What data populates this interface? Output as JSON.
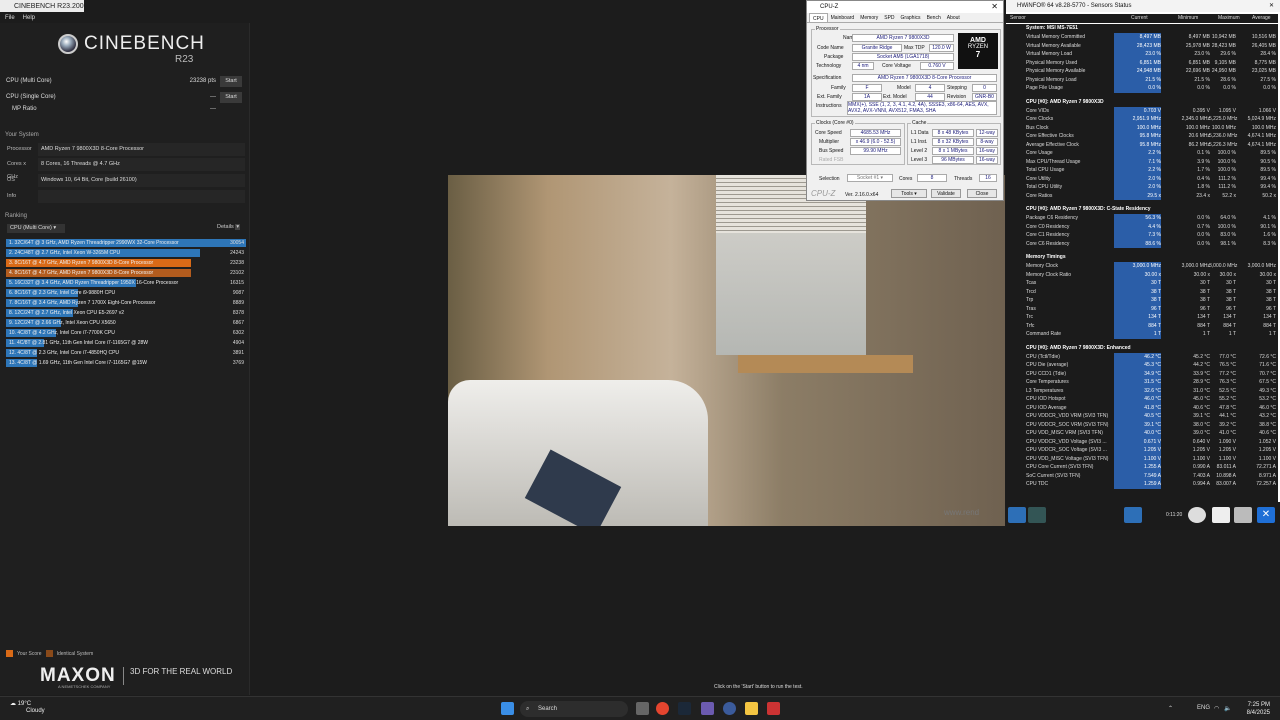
{
  "cinebench": {
    "title": "CINEBENCH R23.200",
    "menu": [
      "File",
      "Help"
    ],
    "logo": "CINEBENCH",
    "logo_sub": "R23",
    "multi_label": "CPU (Multi Core)",
    "multi_score": "23238 pts",
    "single_label": "CPU (Single Core)",
    "single_score": "---",
    "mp_label": "MP Ratio",
    "mp_score": "---",
    "start_label": "Start",
    "your_system": "Your System",
    "system": [
      {
        "k": "Processor",
        "v": "AMD Ryzen 7 9800X3D 8-Core Processor"
      },
      {
        "k": "Cores x GHz",
        "v": "8 Cores, 16 Threads @ 4.7 GHz"
      },
      {
        "k": "OS",
        "v": "Windows 10, 64 Bit, Core (build 26100)"
      },
      {
        "k": "Info",
        "v": ""
      }
    ],
    "ranking": "Ranking",
    "ranking_dd": "CPU (Multi Core)",
    "details": "Details",
    "ranks": [
      {
        "label": "1. 32C/64T @ 3 GHz, AMD Ryzen Threadripper 2990WX 32-Core Processor",
        "score": "30054",
        "frac": 1.0,
        "color": "#2e76b8"
      },
      {
        "label": "2. 24C/48T @ 2.7 GHz, Intel Xeon W-3265M CPU",
        "score": "24243",
        "frac": 0.81,
        "color": "#2e76b8"
      },
      {
        "label": "3. 8C/16T @ 4.7 GHz, AMD Ryzen 7 9800X3D 8-Core Processor",
        "score": "23238",
        "frac": 0.77,
        "color": "#d96a17"
      },
      {
        "label": "4. 8C/16T @ 4.7 GHz, AMD Ryzen 7 9800X3D 8-Core Processor",
        "score": "23102",
        "frac": 0.77,
        "color": "#b35c1e"
      },
      {
        "label": "5. 16C/32T @ 3.4 GHz, AMD Ryzen Threadripper 1950X 16-Core Processor",
        "score": "16315",
        "frac": 0.54,
        "color": "#2e76b8"
      },
      {
        "label": "6. 8C/16T @ 2.3 GHz, Intel Core i9-9880H CPU",
        "score": "9087",
        "frac": 0.3,
        "color": "#2e76b8"
      },
      {
        "label": "7. 8C/16T @ 3.4 GHz, AMD Ryzen 7 1700X Eight-Core Processor",
        "score": "8889",
        "frac": 0.3,
        "color": "#2e76b8"
      },
      {
        "label": "8. 12C/24T @ 2.7 GHz, Intel Xeon CPU E5-2697 v2",
        "score": "8378",
        "frac": 0.28,
        "color": "#2e76b8"
      },
      {
        "label": "9. 12C/24T @ 2.66 GHz, Intel Xeon CPU X5650",
        "score": "6867",
        "frac": 0.23,
        "color": "#2e76b8"
      },
      {
        "label": "10. 4C/8T @ 4.2 GHz, Intel Core i7-7700K CPU",
        "score": "6302",
        "frac": 0.21,
        "color": "#2e76b8"
      },
      {
        "label": "11. 4C/8T @ 2.81 GHz, 11th Gen Intel Core i7-1165G7 @ 28W",
        "score": "4904",
        "frac": 0.16,
        "color": "#2e76b8"
      },
      {
        "label": "12. 4C/8T @ 2.3 GHz, Intel Core i7-4850HQ CPU",
        "score": "3891",
        "frac": 0.13,
        "color": "#2e76b8"
      },
      {
        "label": "13. 4C/8T @ 1.69 GHz, 11th Gen Intel Core i7-1165G7 @15W",
        "score": "3769",
        "frac": 0.13,
        "color": "#2e76b8"
      }
    ],
    "legend_your": "Your Score",
    "legend_identical": "Identical System",
    "maxon": "MAXON",
    "maxon_sub": "A NEMETSCHEK COMPANY",
    "tagline": "3D FOR THE REAL WORLD",
    "status": "Click on the 'Start' button to run the test.",
    "watermark": "www.rend"
  },
  "cpuz": {
    "title": "CPU-Z",
    "tabs": [
      "CPU",
      "Mainboard",
      "Memory",
      "SPD",
      "Graphics",
      "Bench",
      "About"
    ],
    "processor_grp": "Processor",
    "name_k": "Name",
    "name": "AMD Ryzen 7 9800X3D",
    "codename_k": "Code Name",
    "codename": "Granite Ridge",
    "tdp_k": "Max TDP",
    "tdp": "120.0 W",
    "package_k": "Package",
    "package": "Socket AM5 (LGA1718)",
    "tech_k": "Technology",
    "tech": "4 nm",
    "cv_k": "Core Voltage",
    "cv": "0.760 V",
    "spec_k": "Specification",
    "spec": "AMD Ryzen 7 9800X3D 8-Core Processor",
    "family_k": "Family",
    "family": "F",
    "model_k": "Model",
    "model": "4",
    "stepping_k": "Stepping",
    "stepping": "0",
    "extfam_k": "Ext. Family",
    "extfam": "1A",
    "extmod_k": "Ext. Model",
    "extmod": "44",
    "rev_k": "Revision",
    "rev": "GNR-B0",
    "instr_k": "Instructions",
    "instr": "MMX(+), SSE (1, 2, 3, 4.1, 4.2, 4A), SSSE3, x86-64, AES, AVX, AVX2, AVX-VNNI, AVX512, FMA3, SHA",
    "clocks_grp": "Clocks (Core #0)",
    "cs_k": "Core Speed",
    "cs": "4685.53 MHz",
    "mult_k": "Multiplier",
    "mult": "x 46.9 (6.0 - 52.5)",
    "bus_k": "Bus Speed",
    "bus": "99.90 MHz",
    "fsb_k": "Rated FSB",
    "cache_grp": "Cache",
    "l1d_k": "L1 Data",
    "l1d": "8 x 48 KBytes",
    "l1d_w": "12-way",
    "l1i_k": "L1 Inst.",
    "l1i": "8 x 32 KBytes",
    "l1i_w": "8-way",
    "l2_k": "Level 2",
    "l2": "8 x 1 MBytes",
    "l2_w": "16-way",
    "l3_k": "Level 3",
    "l3": "96 MBytes",
    "l3_w": "16-way",
    "sel_k": "Selection",
    "sel": "Socket #1",
    "cores_k": "Cores",
    "cores": "8",
    "threads_k": "Threads",
    "threads": "16",
    "brand": "CPU-Z",
    "ver": "Ver. 2.16.0.x64",
    "tools": "Tools",
    "validate": "Validate",
    "close": "Close",
    "amd": "AMD",
    "ryzen": "RYZEN",
    "seven": "7"
  },
  "hwinfo": {
    "title": "HWiNFO® 64 v8.28-5770 - Sensors Status",
    "cols": {
      "sensor": "Sensor",
      "current": "Current",
      "min": "Minimum",
      "max": "Maximum",
      "avg": "Average"
    },
    "rows": [
      {
        "t": "sec",
        "n": "System: MSI MS-7E51"
      },
      {
        "n": "Virtual Memory Committed",
        "c": "8,497 MB",
        "mi": "8,497 MB",
        "ma": "10,942 MB",
        "av": "10,516 MB"
      },
      {
        "n": "Virtual Memory Available",
        "c": "28,423 MB",
        "mi": "25,978 MB",
        "ma": "28,423 MB",
        "av": "26,405 MB"
      },
      {
        "n": "Virtual Memory Load",
        "c": "23.0 %",
        "mi": "23.0 %",
        "ma": "29.6 %",
        "av": "28.4 %"
      },
      {
        "n": "Physical Memory Used",
        "c": "6,851 MB",
        "mi": "6,851 MB",
        "ma": "9,105 MB",
        "av": "8,775 MB"
      },
      {
        "n": "Physical Memory Available",
        "c": "24,948 MB",
        "mi": "22,696 MB",
        "ma": "24,950 MB",
        "av": "23,025 MB"
      },
      {
        "n": "Physical Memory Load",
        "c": "21.5 %",
        "mi": "21.5 %",
        "ma": "28.6 %",
        "av": "27.5 %"
      },
      {
        "n": "Page File Usage",
        "c": "0.0 %",
        "mi": "0.0 %",
        "ma": "0.0 %",
        "av": "0.0 %"
      },
      {
        "t": "gap"
      },
      {
        "t": "sec",
        "n": "CPU [#0]: AMD Ryzen 7 9800X3D"
      },
      {
        "n": "Core VIDs",
        "c": "0.703 V",
        "mi": "0.395 V",
        "ma": "1.095 V",
        "av": "1.066 V"
      },
      {
        "n": "Core Clocks",
        "c": "2,951.9 MHz",
        "mi": "2,345.0 MHz",
        "ma": "5,225.0 MHz",
        "av": "5,024.9 MHz"
      },
      {
        "n": "Bus Clock",
        "c": "100.0 MHz",
        "mi": "100.0 MHz",
        "ma": "100.0 MHz",
        "av": "100.0 MHz"
      },
      {
        "n": "Core Effective Clocks",
        "c": "95.8 MHz",
        "mi": "20.6 MHz",
        "ma": "5,236.0 MHz",
        "av": "4,674.1 MHz"
      },
      {
        "n": "Average Effective Clock",
        "c": "95.8 MHz",
        "mi": "86.2 MHz",
        "ma": "5,226.3 MHz",
        "av": "4,674.1 MHz"
      },
      {
        "n": "Core Usage",
        "c": "2.2 %",
        "mi": "0.1 %",
        "ma": "100.0 %",
        "av": "89.5 %"
      },
      {
        "n": "Max CPU/Thread Usage",
        "c": "7.1 %",
        "mi": "3.9 %",
        "ma": "100.0 %",
        "av": "90.5 %"
      },
      {
        "n": "Total CPU Usage",
        "c": "2.2 %",
        "mi": "1.7 %",
        "ma": "100.0 %",
        "av": "89.5 %"
      },
      {
        "n": "Core Utility",
        "c": "2.0 %",
        "mi": "0.4 %",
        "ma": "111.2 %",
        "av": "99.4 %"
      },
      {
        "n": "Total CPU Utility",
        "c": "2.0 %",
        "mi": "1.8 %",
        "ma": "111.2 %",
        "av": "99.4 %"
      },
      {
        "n": "Core Ratios",
        "c": "29.5 x",
        "mi": "23.4 x",
        "ma": "52.2 x",
        "av": "50.2 x"
      },
      {
        "t": "gap"
      },
      {
        "t": "sec",
        "n": "CPU [#0]: AMD Ryzen 7 9800X3D: C-State Residency"
      },
      {
        "n": "Package C6 Residency",
        "c": "56.3 %",
        "mi": "0.0 %",
        "ma": "64.0 %",
        "av": "4.1 %"
      },
      {
        "n": "Core C0 Residency",
        "c": "4.4 %",
        "mi": "0.7 %",
        "ma": "100.0 %",
        "av": "90.1 %"
      },
      {
        "n": "Core C1 Residency",
        "c": "7.3 %",
        "mi": "0.0 %",
        "ma": "83.0 %",
        "av": "1.6 %"
      },
      {
        "n": "Core C6 Residency",
        "c": "88.6 %",
        "mi": "0.0 %",
        "ma": "98.1 %",
        "av": "8.3 %"
      },
      {
        "t": "gap"
      },
      {
        "t": "sec",
        "n": "Memory Timings"
      },
      {
        "n": "Memory Clock",
        "c": "3,000.0 MHz",
        "mi": "3,000.0 MHz",
        "ma": "3,000.0 MHz",
        "av": "3,000.0 MHz"
      },
      {
        "n": "Memory Clock Ratio",
        "c": "30.00 x",
        "mi": "30.00 x",
        "ma": "30.00 x",
        "av": "30.00 x"
      },
      {
        "n": "Tcas",
        "c": "30 T",
        "mi": "30 T",
        "ma": "30 T",
        "av": "30 T"
      },
      {
        "n": "Trcd",
        "c": "38 T",
        "mi": "38 T",
        "ma": "38 T",
        "av": "38 T"
      },
      {
        "n": "Trp",
        "c": "38 T",
        "mi": "38 T",
        "ma": "38 T",
        "av": "38 T"
      },
      {
        "n": "Tras",
        "c": "96 T",
        "mi": "96 T",
        "ma": "96 T",
        "av": "96 T"
      },
      {
        "n": "Trc",
        "c": "134 T",
        "mi": "134 T",
        "ma": "134 T",
        "av": "134 T"
      },
      {
        "n": "Trfc",
        "c": "884 T",
        "mi": "884 T",
        "ma": "884 T",
        "av": "884 T"
      },
      {
        "n": "Command Rate",
        "c": "1 T",
        "mi": "1 T",
        "ma": "1 T",
        "av": "1 T"
      },
      {
        "t": "gap"
      },
      {
        "t": "sec",
        "n": "CPU [#0]: AMD Ryzen 7 9800X3D: Enhanced"
      },
      {
        "n": "CPU (Tctl/Tdie)",
        "c": "46.2 °C",
        "mi": "45.2 °C",
        "ma": "77.0 °C",
        "av": "72.6 °C"
      },
      {
        "n": "CPU Die (average)",
        "c": "45.3 °C",
        "mi": "44.2 °C",
        "ma": "76.5 °C",
        "av": "71.6 °C"
      },
      {
        "n": "CPU CCD1 (Tdie)",
        "c": "34.9 °C",
        "mi": "33.9 °C",
        "ma": "77.2 °C",
        "av": "70.7 °C"
      },
      {
        "n": "Core Temperatures",
        "c": "31.5 °C",
        "mi": "28.9 °C",
        "ma": "76.3 °C",
        "av": "67.5 °C"
      },
      {
        "n": "L3 Temperatures",
        "c": "32.6 °C",
        "mi": "31.0 °C",
        "ma": "52.5 °C",
        "av": "49.3 °C"
      },
      {
        "n": "CPU IOD Hotspot",
        "c": "46.0 °C",
        "mi": "45.0 °C",
        "ma": "55.2 °C",
        "av": "53.2 °C"
      },
      {
        "n": "CPU IOD Average",
        "c": "41.8 °C",
        "mi": "40.6 °C",
        "ma": "47.8 °C",
        "av": "46.0 °C"
      },
      {
        "n": "CPU VDDCR_VDD VRM (SVI3 TFN)",
        "c": "40.5 °C",
        "mi": "39.1 °C",
        "ma": "44.1 °C",
        "av": "43.2 °C"
      },
      {
        "n": "CPU VDDCR_SOC VRM (SVI3 TFN)",
        "c": "39.1 °C",
        "mi": "38.0 °C",
        "ma": "39.2 °C",
        "av": "38.8 °C"
      },
      {
        "n": "CPU VDD_MISC VRM (SVI3 TFN)",
        "c": "40.0 °C",
        "mi": "39.0 °C",
        "ma": "41.0 °C",
        "av": "40.6 °C"
      },
      {
        "n": "CPU VDDCR_VDD Voltage (SVI3 ...",
        "c": "0.671 V",
        "mi": "0.640 V",
        "ma": "1.090 V",
        "av": "1.052 V"
      },
      {
        "n": "CPU VDDCR_SOC Voltage (SVI3 ...",
        "c": "1.205 V",
        "mi": "1.205 V",
        "ma": "1.205 V",
        "av": "1.205 V"
      },
      {
        "n": "CPU VDD_MISC Voltage (SVI3 TFN)",
        "c": "1.100 V",
        "mi": "1.100 V",
        "ma": "1.100 V",
        "av": "1.100 V"
      },
      {
        "n": "CPU Core Current (SVI3 TFN)",
        "c": "1.255 A",
        "mi": "0.990 A",
        "ma": "83.011 A",
        "av": "72.271 A"
      },
      {
        "n": "SoC Current (SVI3 TFN)",
        "c": "7.549 A",
        "mi": "7.403 A",
        "ma": "10.898 A",
        "av": "8.971 A"
      },
      {
        "n": "CPU TDC",
        "c": "1.259 A",
        "mi": "0.994 A",
        "ma": "83.007 A",
        "av": "72.257 A"
      }
    ],
    "timer": "0:11:20"
  },
  "taskbar": {
    "temp": "19°C",
    "weather": "Cloudy",
    "search": "Search",
    "lang": "ENG",
    "time": "7:25 PM",
    "date": "8/4/2025"
  }
}
